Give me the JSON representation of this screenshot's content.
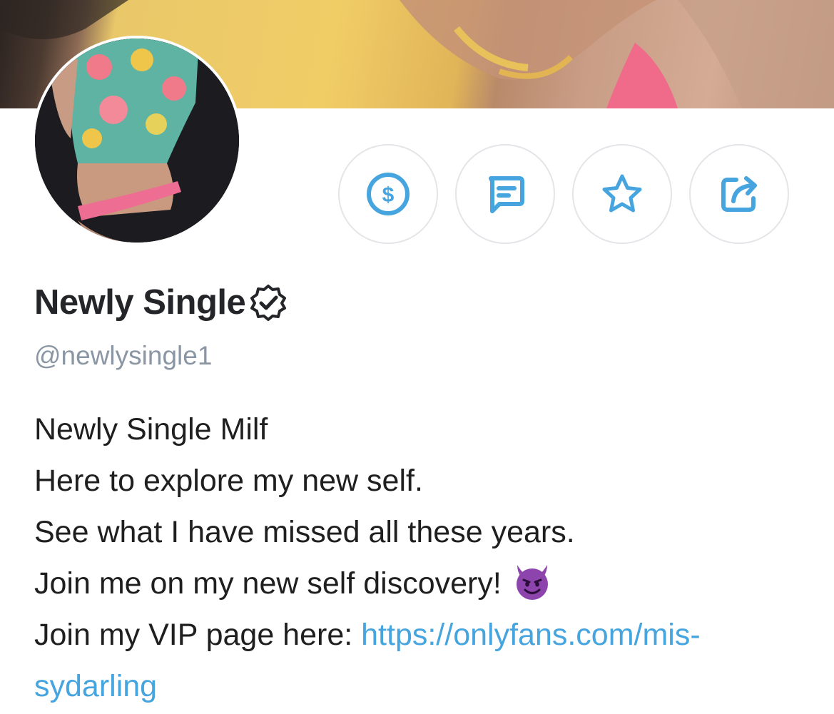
{
  "profile": {
    "display_name": "Newly Single",
    "handle": "@newlysingle1",
    "verified": true,
    "bio": {
      "line1": "Newly Single Milf",
      "line2": "Here to explore my new self.",
      "line3": "See what I have missed all these years.",
      "line4": "Join me on my new self discovery!",
      "line4_emoji": "smiling-devil-emoji",
      "line5_prefix": "Join my VIP page here: ",
      "link_part1": "https://onlyfans.com/mis-",
      "link_part2": "sydarling"
    }
  },
  "actions": [
    {
      "icon": "dollar-circle-icon"
    },
    {
      "icon": "message-icon"
    },
    {
      "icon": "star-icon"
    },
    {
      "icon": "share-icon"
    }
  ],
  "colors": {
    "accent": "#46a4de",
    "handle_gray": "#8a96a3",
    "border": "#e3e5e8",
    "devil_purple": "#8e44ad"
  }
}
